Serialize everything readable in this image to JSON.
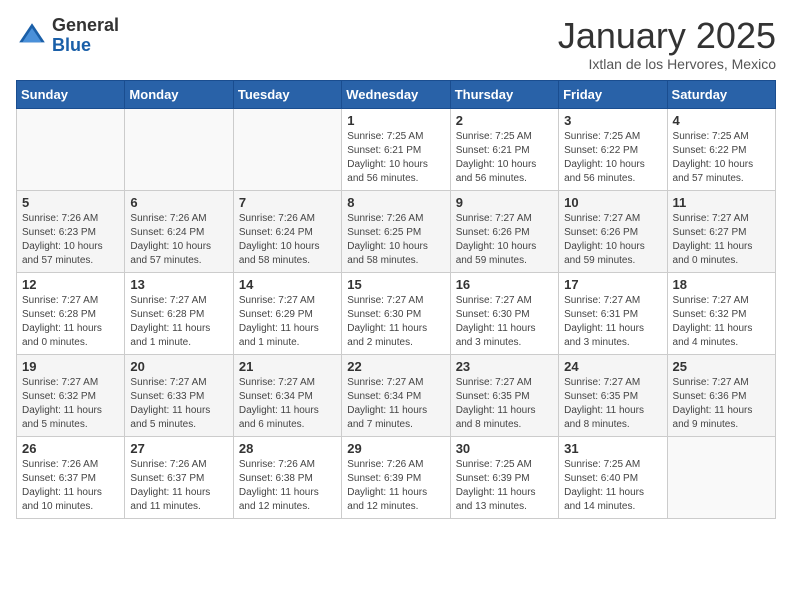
{
  "header": {
    "logo_general": "General",
    "logo_blue": "Blue",
    "month_title": "January 2025",
    "location": "Ixtlan de los Hervores, Mexico"
  },
  "weekdays": [
    "Sunday",
    "Monday",
    "Tuesday",
    "Wednesday",
    "Thursday",
    "Friday",
    "Saturday"
  ],
  "weeks": [
    [
      {
        "day": "",
        "info": ""
      },
      {
        "day": "",
        "info": ""
      },
      {
        "day": "",
        "info": ""
      },
      {
        "day": "1",
        "info": "Sunrise: 7:25 AM\nSunset: 6:21 PM\nDaylight: 10 hours and 56 minutes."
      },
      {
        "day": "2",
        "info": "Sunrise: 7:25 AM\nSunset: 6:21 PM\nDaylight: 10 hours and 56 minutes."
      },
      {
        "day": "3",
        "info": "Sunrise: 7:25 AM\nSunset: 6:22 PM\nDaylight: 10 hours and 56 minutes."
      },
      {
        "day": "4",
        "info": "Sunrise: 7:25 AM\nSunset: 6:22 PM\nDaylight: 10 hours and 57 minutes."
      }
    ],
    [
      {
        "day": "5",
        "info": "Sunrise: 7:26 AM\nSunset: 6:23 PM\nDaylight: 10 hours and 57 minutes."
      },
      {
        "day": "6",
        "info": "Sunrise: 7:26 AM\nSunset: 6:24 PM\nDaylight: 10 hours and 57 minutes."
      },
      {
        "day": "7",
        "info": "Sunrise: 7:26 AM\nSunset: 6:24 PM\nDaylight: 10 hours and 58 minutes."
      },
      {
        "day": "8",
        "info": "Sunrise: 7:26 AM\nSunset: 6:25 PM\nDaylight: 10 hours and 58 minutes."
      },
      {
        "day": "9",
        "info": "Sunrise: 7:27 AM\nSunset: 6:26 PM\nDaylight: 10 hours and 59 minutes."
      },
      {
        "day": "10",
        "info": "Sunrise: 7:27 AM\nSunset: 6:26 PM\nDaylight: 10 hours and 59 minutes."
      },
      {
        "day": "11",
        "info": "Sunrise: 7:27 AM\nSunset: 6:27 PM\nDaylight: 11 hours and 0 minutes."
      }
    ],
    [
      {
        "day": "12",
        "info": "Sunrise: 7:27 AM\nSunset: 6:28 PM\nDaylight: 11 hours and 0 minutes."
      },
      {
        "day": "13",
        "info": "Sunrise: 7:27 AM\nSunset: 6:28 PM\nDaylight: 11 hours and 1 minute."
      },
      {
        "day": "14",
        "info": "Sunrise: 7:27 AM\nSunset: 6:29 PM\nDaylight: 11 hours and 1 minute."
      },
      {
        "day": "15",
        "info": "Sunrise: 7:27 AM\nSunset: 6:30 PM\nDaylight: 11 hours and 2 minutes."
      },
      {
        "day": "16",
        "info": "Sunrise: 7:27 AM\nSunset: 6:30 PM\nDaylight: 11 hours and 3 minutes."
      },
      {
        "day": "17",
        "info": "Sunrise: 7:27 AM\nSunset: 6:31 PM\nDaylight: 11 hours and 3 minutes."
      },
      {
        "day": "18",
        "info": "Sunrise: 7:27 AM\nSunset: 6:32 PM\nDaylight: 11 hours and 4 minutes."
      }
    ],
    [
      {
        "day": "19",
        "info": "Sunrise: 7:27 AM\nSunset: 6:32 PM\nDaylight: 11 hours and 5 minutes."
      },
      {
        "day": "20",
        "info": "Sunrise: 7:27 AM\nSunset: 6:33 PM\nDaylight: 11 hours and 5 minutes."
      },
      {
        "day": "21",
        "info": "Sunrise: 7:27 AM\nSunset: 6:34 PM\nDaylight: 11 hours and 6 minutes."
      },
      {
        "day": "22",
        "info": "Sunrise: 7:27 AM\nSunset: 6:34 PM\nDaylight: 11 hours and 7 minutes."
      },
      {
        "day": "23",
        "info": "Sunrise: 7:27 AM\nSunset: 6:35 PM\nDaylight: 11 hours and 8 minutes."
      },
      {
        "day": "24",
        "info": "Sunrise: 7:27 AM\nSunset: 6:35 PM\nDaylight: 11 hours and 8 minutes."
      },
      {
        "day": "25",
        "info": "Sunrise: 7:27 AM\nSunset: 6:36 PM\nDaylight: 11 hours and 9 minutes."
      }
    ],
    [
      {
        "day": "26",
        "info": "Sunrise: 7:26 AM\nSunset: 6:37 PM\nDaylight: 11 hours and 10 minutes."
      },
      {
        "day": "27",
        "info": "Sunrise: 7:26 AM\nSunset: 6:37 PM\nDaylight: 11 hours and 11 minutes."
      },
      {
        "day": "28",
        "info": "Sunrise: 7:26 AM\nSunset: 6:38 PM\nDaylight: 11 hours and 12 minutes."
      },
      {
        "day": "29",
        "info": "Sunrise: 7:26 AM\nSunset: 6:39 PM\nDaylight: 11 hours and 12 minutes."
      },
      {
        "day": "30",
        "info": "Sunrise: 7:25 AM\nSunset: 6:39 PM\nDaylight: 11 hours and 13 minutes."
      },
      {
        "day": "31",
        "info": "Sunrise: 7:25 AM\nSunset: 6:40 PM\nDaylight: 11 hours and 14 minutes."
      },
      {
        "day": "",
        "info": ""
      }
    ]
  ]
}
